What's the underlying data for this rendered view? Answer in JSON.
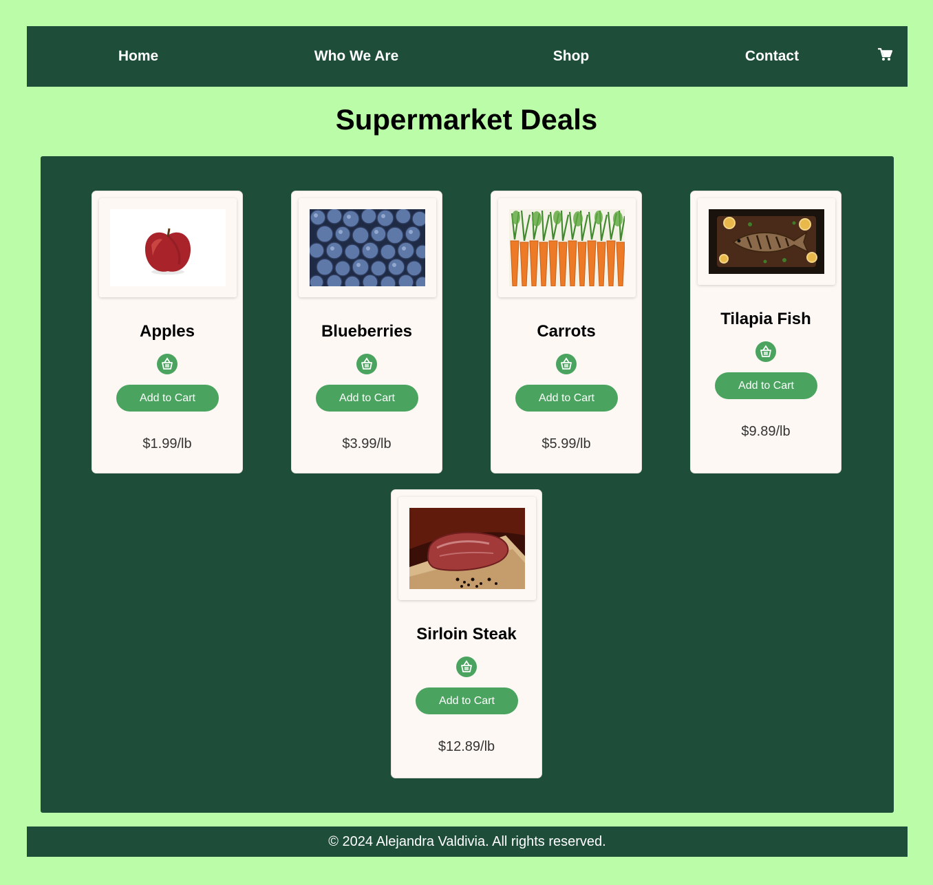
{
  "nav": {
    "items": [
      {
        "label": "Home"
      },
      {
        "label": "Who We Are"
      },
      {
        "label": "Shop"
      },
      {
        "label": "Contact"
      }
    ],
    "cart_icon": "shopping-cart-icon"
  },
  "page": {
    "title": "Supermarket Deals"
  },
  "products": [
    {
      "name": "Apples",
      "price": "$1.99/lb",
      "button": "Add to Cart",
      "icon": "basket-icon"
    },
    {
      "name": "Blueberries",
      "price": "$3.99/lb",
      "button": "Add to Cart",
      "icon": "basket-icon"
    },
    {
      "name": "Carrots",
      "price": "$5.99/lb",
      "button": "Add to Cart",
      "icon": "basket-icon"
    },
    {
      "name": "Tilapia Fish",
      "price": "$9.89/lb",
      "button": "Add to Cart",
      "icon": "basket-icon"
    },
    {
      "name": "Sirloin Steak",
      "price": "$12.89/lb",
      "button": "Add to Cart",
      "icon": "basket-icon"
    }
  ],
  "footer": {
    "text": "© 2024 Alejandra Valdivia. All rights reserved."
  },
  "colors": {
    "background": "#bafca8",
    "dark_green": "#1e4d3a",
    "button_green": "#4aa35f",
    "card": "#fdf8f3"
  }
}
